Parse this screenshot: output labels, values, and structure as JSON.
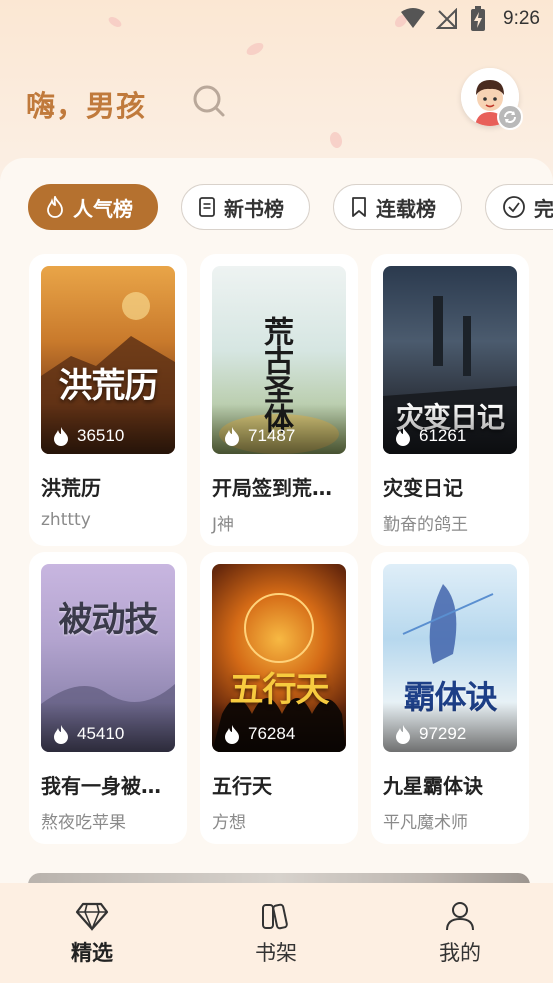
{
  "status_bar": {
    "time": "9:26"
  },
  "header": {
    "greeting": "嗨，男孩"
  },
  "tabs": [
    {
      "label": "人气榜",
      "icon": "flame-icon",
      "active": true
    },
    {
      "label": "新书榜",
      "icon": "document-icon",
      "active": false
    },
    {
      "label": "连载榜",
      "icon": "bookmark-icon",
      "active": false
    },
    {
      "label": "完",
      "icon": "check-circle-icon",
      "active": false
    }
  ],
  "books": [
    {
      "cover_text": "洪荒历",
      "heat": "36510",
      "title": "洪荒历",
      "author": "zhttty"
    },
    {
      "cover_text": "荒古圣体",
      "heat": "71487",
      "title": "开局签到荒…",
      "author": "J神"
    },
    {
      "cover_text": "灾变日记",
      "heat": "61261",
      "title": "灾变日记",
      "author": "勤奋的鸽王"
    },
    {
      "cover_text": "被动技",
      "heat": "45410",
      "title": "我有一身被…",
      "author": "熬夜吃苹果"
    },
    {
      "cover_text": "五行天",
      "heat": "76284",
      "title": "五行天",
      "author": "方想"
    },
    {
      "cover_text": "霸体诀",
      "heat": "97292",
      "title": "九星霸体诀",
      "author": "平凡魔术师"
    }
  ],
  "bottom_nav": [
    {
      "label": "精选",
      "icon": "diamond-icon",
      "active": true
    },
    {
      "label": "书架",
      "icon": "books-icon",
      "active": false
    },
    {
      "label": "我的",
      "icon": "person-icon",
      "active": false
    }
  ],
  "colors": {
    "accent": "#b5712f",
    "greeting": "#c07a3c"
  }
}
